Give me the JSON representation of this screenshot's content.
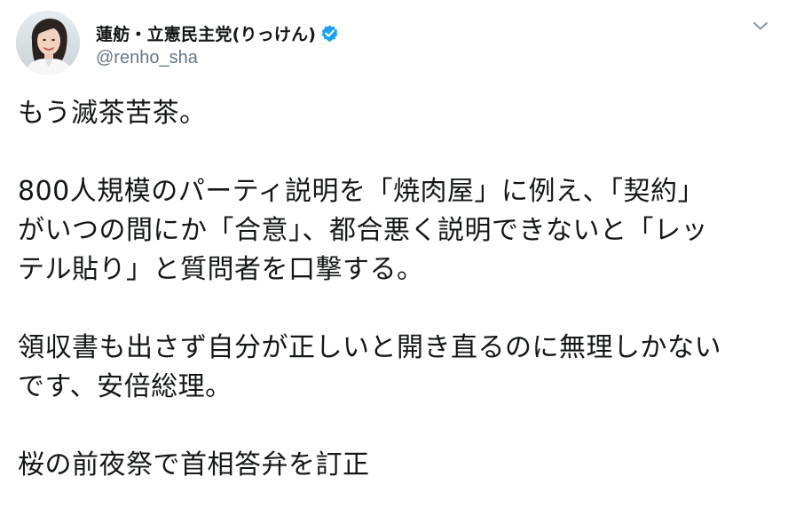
{
  "tweet": {
    "author": {
      "display_name": "蓮舫・立憲民主党(りっけん)",
      "handle": "@renho_sha",
      "verified_icon": "verified-badge-icon",
      "avatar": "profile-photo"
    },
    "menu_icon": "chevron-down-icon",
    "paragraphs": [
      {
        "lines": [
          "もう滅茶苦茶。"
        ]
      },
      {
        "lines": [
          "800人規模のパーティ説明を「焼肉屋」に例え、「契約」",
          "がいつの間にか「合意」、都合悪く説明できないと「レッ",
          "テル貼り」と質問者を口撃する。"
        ]
      },
      {
        "lines": [
          "領収書も出さず自分が正しいと開き直るのに無理しかない",
          "です、安倍総理。"
        ]
      },
      {
        "lines": [
          "桜の前夜祭で首相答弁を訂正"
        ]
      }
    ]
  },
  "colors": {
    "text": "#14171a",
    "secondary": "#657786",
    "verified_blue": "#1da1f2",
    "background": "#ffffff"
  }
}
